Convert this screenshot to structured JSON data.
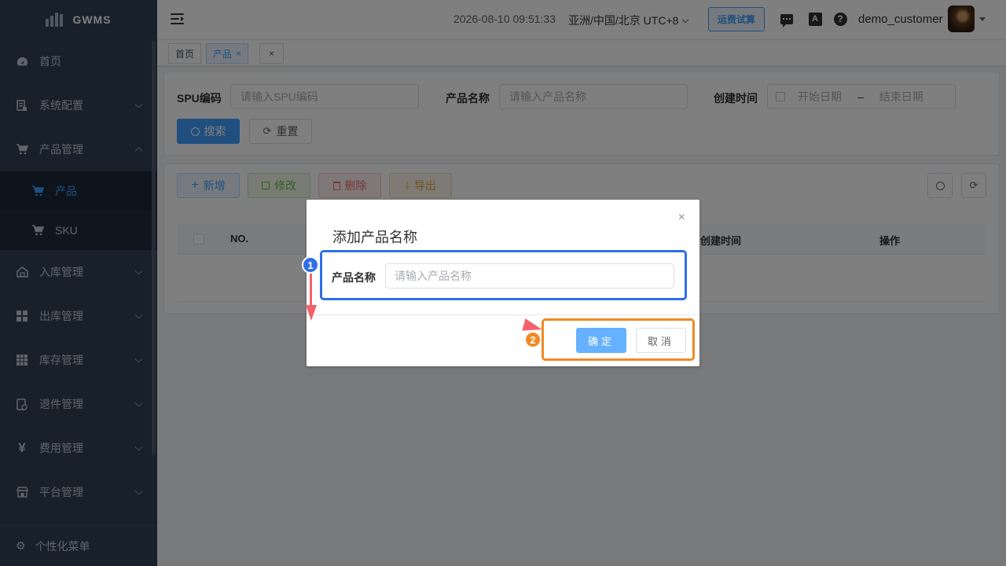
{
  "sidebar": {
    "logo": "GWMS",
    "items": [
      {
        "label": "首页"
      },
      {
        "label": "系统配置"
      },
      {
        "label": "产品管理"
      },
      {
        "label": "入库管理"
      },
      {
        "label": "出库管理"
      },
      {
        "label": "库存管理"
      },
      {
        "label": "退件管理"
      },
      {
        "label": "费用管理"
      },
      {
        "label": "平台管理"
      }
    ],
    "subitems": [
      {
        "label": "产品",
        "active": true
      },
      {
        "label": "SKU",
        "active": false
      }
    ],
    "footer": "个性化菜单"
  },
  "navbar": {
    "datetime": "2026-08-10 09:51:33",
    "timezone": "亚洲/中国/北京 UTC+8",
    "calc_button": "运费试算",
    "lang_glyph": "A",
    "help_glyph": "?",
    "username": "demo_customer"
  },
  "tags": [
    {
      "label": "首页",
      "active": false
    },
    {
      "label": "产品",
      "active": true,
      "closable": true
    }
  ],
  "tag_close": "×",
  "search": {
    "spu_label": "SPU编码",
    "spu_placeholder": "请输入SPU编码",
    "name_label": "产品名称",
    "name_placeholder": "请输入产品名称",
    "time_label": "创建时间",
    "start_placeholder": "开始日期",
    "range_sep": "–",
    "end_placeholder": "结束日期",
    "search_button": "搜索",
    "reset_button": "重置"
  },
  "toolbar": {
    "add": "新增",
    "edit": "修改",
    "delete": "删除",
    "export": "导出"
  },
  "table": {
    "columns": [
      "NO.",
      "创建时间",
      "操作"
    ]
  },
  "dialog": {
    "title": "添加产品名称",
    "close": "×",
    "field_label": "产品名称",
    "field_placeholder": "请输入产品名称",
    "ok": "确定",
    "cancel": "取消"
  },
  "annotations": {
    "step1": "1",
    "step2": "2"
  },
  "colors": {
    "primary": "#409eff",
    "sidebar_bg": "#304156",
    "annotation_blue": "#2f6fe6",
    "annotation_orange": "#f08a24",
    "arrow_red": "#f5616b"
  }
}
